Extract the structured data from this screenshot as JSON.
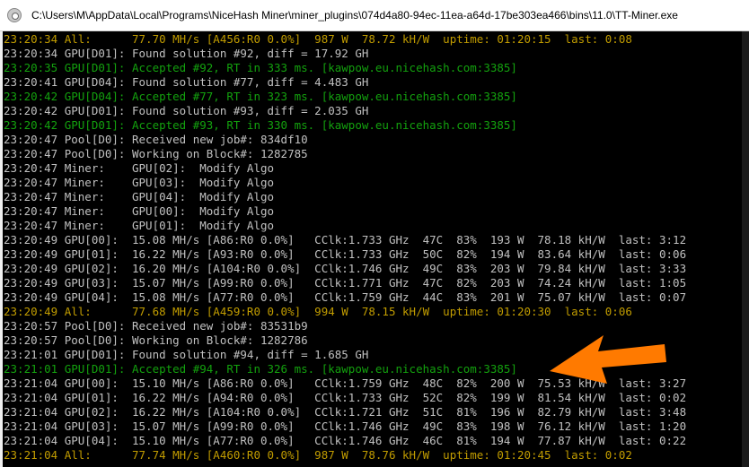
{
  "window": {
    "title": "C:\\Users\\M\\AppData\\Local\\Programs\\NiceHash Miner\\miner_plugins\\074d4a80-94ec-11ea-a64d-17be303ea466\\bins\\11.0\\TT-Miner.exe"
  },
  "colors": {
    "background": "#000000",
    "text": "#c0c0c0",
    "accepted": "#13a10e",
    "summary": "#c19c00",
    "arrow": "#ff7a00"
  },
  "console": {
    "lines": [
      {
        "text": "23:20:34 All:      77.70 MH/s [A456:R0 0.0%]  987 W  78.72 kH/W  uptime: 01:20:15  last: 0:08",
        "style": "yellow"
      },
      {
        "text": "23:20:34 GPU[D01]: Found solution #92, diff = 17.92 GH",
        "style": "gray"
      },
      {
        "text": "23:20:35 GPU[D01]: Accepted #92, RT in 333 ms. [kawpow.eu.nicehash.com:3385]",
        "style": "green"
      },
      {
        "text": "23:20:41 GPU[D04]: Found solution #77, diff = 4.483 GH",
        "style": "gray"
      },
      {
        "text": "23:20:42 GPU[D04]: Accepted #77, RT in 323 ms. [kawpow.eu.nicehash.com:3385]",
        "style": "green"
      },
      {
        "text": "23:20:42 GPU[D01]: Found solution #93, diff = 2.035 GH",
        "style": "gray"
      },
      {
        "text": "23:20:42 GPU[D01]: Accepted #93, RT in 330 ms. [kawpow.eu.nicehash.com:3385]",
        "style": "green"
      },
      {
        "text": "23:20:47 Pool[D0]: Received new job#: 834df10",
        "style": "gray"
      },
      {
        "text": "23:20:47 Pool[D0]: Working on Block#: 1282785",
        "style": "gray"
      },
      {
        "text": "23:20:47 Miner:    GPU[02]:  Modify Algo",
        "style": "gray"
      },
      {
        "text": "23:20:47 Miner:    GPU[03]:  Modify Algo",
        "style": "gray"
      },
      {
        "text": "23:20:47 Miner:    GPU[04]:  Modify Algo",
        "style": "gray"
      },
      {
        "text": "23:20:47 Miner:    GPU[00]:  Modify Algo",
        "style": "gray"
      },
      {
        "text": "23:20:47 Miner:    GPU[01]:  Modify Algo",
        "style": "gray"
      },
      {
        "text": "23:20:49 GPU[00]:  15.08 MH/s [A86:R0 0.0%]   CClk:1.733 GHz  47C  83%  193 W  78.18 kH/W  last: 3:12",
        "style": "gray"
      },
      {
        "text": "23:20:49 GPU[01]:  16.22 MH/s [A93:R0 0.0%]   CClk:1.733 GHz  50C  82%  194 W  83.64 kH/W  last: 0:06",
        "style": "gray"
      },
      {
        "text": "23:20:49 GPU[02]:  16.20 MH/s [A104:R0 0.0%]  CClk:1.746 GHz  49C  83%  203 W  79.84 kH/W  last: 3:33",
        "style": "gray"
      },
      {
        "text": "23:20:49 GPU[03]:  15.07 MH/s [A99:R0 0.0%]   CClk:1.771 GHz  47C  82%  203 W  74.24 kH/W  last: 1:05",
        "style": "gray"
      },
      {
        "text": "23:20:49 GPU[04]:  15.08 MH/s [A77:R0 0.0%]   CClk:1.759 GHz  44C  83%  201 W  75.07 kH/W  last: 0:07",
        "style": "gray"
      },
      {
        "text": "23:20:49 All:      77.68 MH/s [A459:R0 0.0%]  994 W  78.15 kH/W  uptime: 01:20:30  last: 0:06",
        "style": "yellow"
      },
      {
        "text": "23:20:57 Pool[D0]: Received new job#: 83531b9",
        "style": "gray"
      },
      {
        "text": "23:20:57 Pool[D0]: Working on Block#: 1282786",
        "style": "gray"
      },
      {
        "text": "23:21:01 GPU[D01]: Found solution #94, diff = 1.685 GH",
        "style": "gray"
      },
      {
        "text": "23:21:01 GPU[D01]: Accepted #94, RT in 326 ms. [kawpow.eu.nicehash.com:3385]",
        "style": "green"
      },
      {
        "text": "23:21:04 GPU[00]:  15.10 MH/s [A86:R0 0.0%]   CClk:1.759 GHz  48C  82%  200 W  75.53 kH/W  last: 3:27",
        "style": "gray"
      },
      {
        "text": "23:21:04 GPU[01]:  16.22 MH/s [A94:R0 0.0%]   CClk:1.733 GHz  52C  82%  199 W  81.54 kH/W  last: 0:02",
        "style": "gray"
      },
      {
        "text": "23:21:04 GPU[02]:  16.22 MH/s [A104:R0 0.0%]  CClk:1.721 GHz  51C  81%  196 W  82.79 kH/W  last: 3:48",
        "style": "gray"
      },
      {
        "text": "23:21:04 GPU[03]:  15.07 MH/s [A99:R0 0.0%]   CClk:1.746 GHz  49C  83%  198 W  76.12 kH/W  last: 1:20",
        "style": "gray"
      },
      {
        "text": "23:21:04 GPU[04]:  15.10 MH/s [A77:R0 0.0%]   CClk:1.746 GHz  46C  81%  194 W  77.87 kH/W  last: 0:22",
        "style": "gray"
      },
      {
        "text": "23:21:04 All:      77.74 MH/s [A460:R0 0.0%]  987 W  78.76 kH/W  uptime: 01:20:45  last: 0:02",
        "style": "yellow"
      }
    ]
  }
}
